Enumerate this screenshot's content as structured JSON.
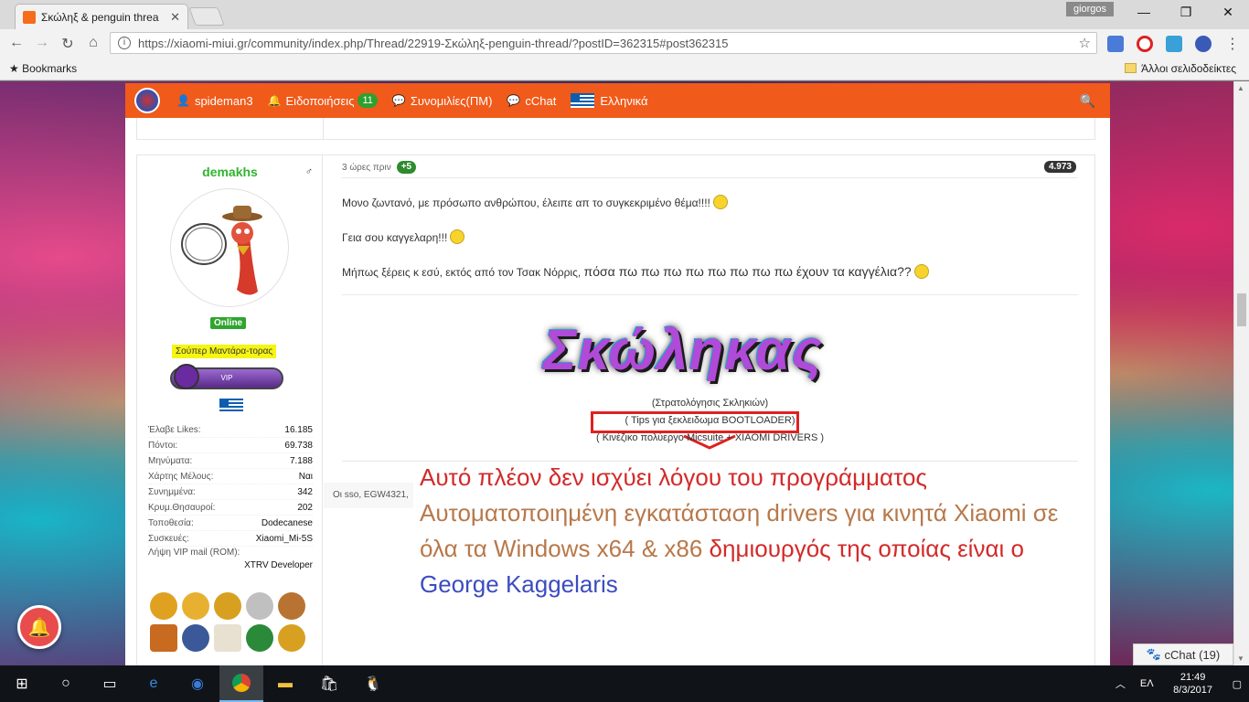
{
  "browser": {
    "tab_title": "Σκώληξ & penguin threa",
    "user": "giorgos",
    "url": "https://xiaomi-miui.gr/community/index.php/Thread/22919-Σκώληξ-penguin-thread/?postID=362315#post362315",
    "bookmarks_label": "Bookmarks",
    "other_bookmarks": "Άλλοι σελιδοδείκτες"
  },
  "site_nav": {
    "username": "spideman3",
    "notifications": "Ειδοποιήσεις",
    "notifications_count": "11",
    "conversations": "Συνομιλίες(ΠΜ)",
    "chat": "cChat",
    "language": "Ελληνικά"
  },
  "author": {
    "name": "demakhs",
    "status": "Online",
    "rank": "Σούπερ Μαντάρα-τορας",
    "vip": "VIP",
    "stats": [
      {
        "k": "Έλαβε Likes:",
        "v": "16.185"
      },
      {
        "k": "Πόντοι:",
        "v": "69.738"
      },
      {
        "k": "Μηνύματα:",
        "v": "7.188"
      },
      {
        "k": "Χάρτης Μέλους:",
        "v": "Ναι"
      },
      {
        "k": "Συνημμένα:",
        "v": "342"
      },
      {
        "k": "Κρυμ.Θησαυροί:",
        "v": "202"
      },
      {
        "k": "Τοποθεσία:",
        "v": "Dodecanese"
      },
      {
        "k": "Συσκευές:",
        "v": "Xiaomi_Mi-5S"
      }
    ],
    "vip_mail_label": "Λήψη VIP mail (ROM):",
    "vip_mail_value": "XTRV Developer"
  },
  "post": {
    "time": "3 ώρες πριν",
    "likes": "+5",
    "post_number": "4.973",
    "line1": "Μονο ζωντανό, με πρόσωπο ανθρώπου, έλειπε απ το συγκεκριμένο θέμα!!!!",
    "line2": "Γεια σου καγγελαρη!!!",
    "line3_a": "Μήπως ξέρεις κ εσύ, εκτός από τον Τσακ Νόρρις,",
    "line3_b": "πόσα πω πω πω πω πω πω πω πω έχουν τα καγγέλια??"
  },
  "signature": {
    "title": "Σκώληκας",
    "line1": "(Στρατολόγησις Σκληκιών)",
    "line2": "( Tips για ξεκλειδωμα BOOTLOADER)",
    "line3": "( Κινέζικο  πολύεργο  Micsuite  +  XIAOMI DRIVERS )",
    "quote_label": "Οι sso, EGW4321,",
    "big_red_1": "Αυτό πλέον δεν ισχύει λόγου του προγράμματος",
    "big_tan": "Αυτοματοποιημένη εγκατάσταση drivers για κινητά Xiaomi σε όλα τα Windows x64 & x86",
    "big_red_2": "δημιουργός της οποίας είναι ο",
    "big_blue": "George Kaggelaris"
  },
  "chat_widget": "cChat (19)",
  "taskbar": {
    "lang": "ΕΛ",
    "time": "21:49",
    "date": "8/3/2017"
  },
  "colors": {
    "site_orange": "#f05a1a",
    "online_green": "#2fa52f",
    "highlight_red": "#e02020"
  }
}
